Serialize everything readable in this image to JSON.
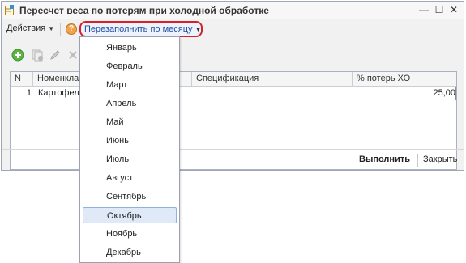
{
  "window": {
    "title": "Пересчет веса по потерям при холодной обработке"
  },
  "toolbar": {
    "actions_label": "Действия",
    "refill_label": "Перезаполнить по месяцу"
  },
  "grid": {
    "columns": [
      "N",
      "Номенклатура",
      "Спецификация",
      "% потерь ХО"
    ],
    "rows": [
      {
        "n": "1",
        "nomenclature": "Картофель",
        "spec": "",
        "pct": "25,00"
      }
    ]
  },
  "bottom": {
    "run_label": "Выполнить",
    "close_label": "Закрыть"
  },
  "dropdown": {
    "items": [
      "Январь",
      "Февраль",
      "Март",
      "Апрель",
      "Май",
      "Июнь",
      "Июль",
      "Август",
      "Сентябрь",
      "Октябрь",
      "Ноябрь",
      "Декабрь"
    ],
    "selected": "Октябрь"
  },
  "icons": {
    "app": "form-edit-icon",
    "help": "help-icon",
    "add": "add-row-icon",
    "copy": "copy-row-icon",
    "edit": "edit-row-icon",
    "delete": "delete-row-icon"
  },
  "colors": {
    "highlight_border": "#d8202a",
    "selected_bg": "#dfe9f8",
    "link_text": "#1f4da3"
  }
}
